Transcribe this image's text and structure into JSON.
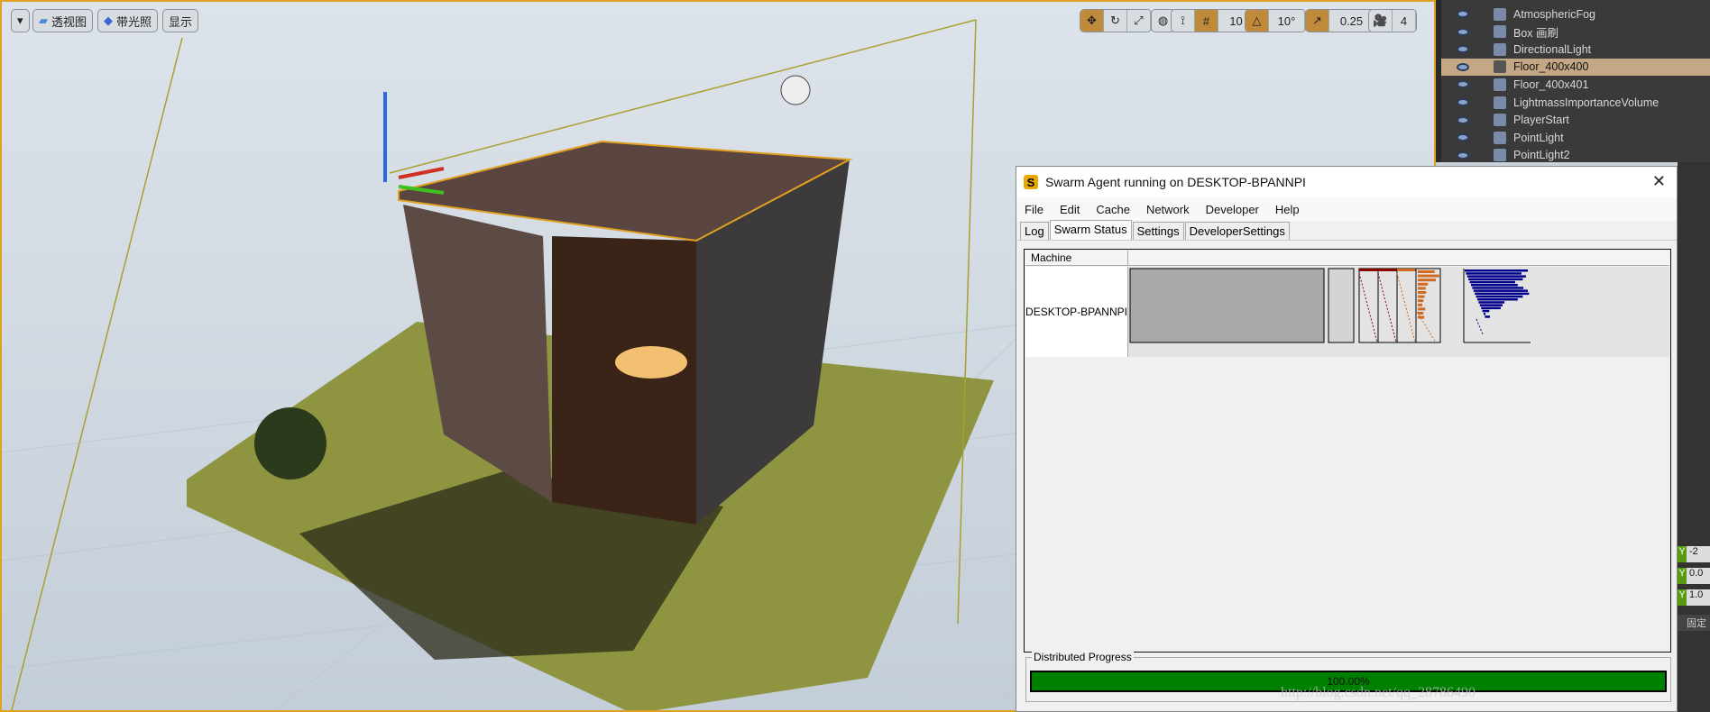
{
  "viewport": {
    "toolbar_left": [
      {
        "label": "",
        "icon": "chevron-down-icon"
      },
      {
        "label": "透视图",
        "icon": "perspective-icon"
      },
      {
        "label": "带光照",
        "icon": "lit-cube-icon"
      },
      {
        "label": "显示",
        "icon": ""
      }
    ],
    "toolbar_right": {
      "grid_snap": "10",
      "rotation_snap": "10°",
      "scale_snap": "0.25",
      "camera_speed": "4"
    },
    "accent": "#c08a3a"
  },
  "outliner": {
    "items": [
      {
        "label": "AtmosphericFog",
        "icon": "fog-icon",
        "selected": false
      },
      {
        "label": "Box 画刷",
        "icon": "brush-icon",
        "selected": false
      },
      {
        "label": "DirectionalLight",
        "icon": "directional-light-icon",
        "selected": false
      },
      {
        "label": "Floor_400x400",
        "icon": "static-mesh-icon",
        "selected": true
      },
      {
        "label": "Floor_400x401",
        "icon": "static-mesh-icon",
        "selected": false
      },
      {
        "label": "LightmassImportanceVolume",
        "icon": "volume-icon",
        "selected": false
      },
      {
        "label": "PlayerStart",
        "icon": "player-start-icon",
        "selected": false
      },
      {
        "label": "PointLight",
        "icon": "point-light-icon",
        "selected": false
      },
      {
        "label": "PointLight2",
        "icon": "point-light-icon",
        "selected": false
      }
    ]
  },
  "details": {
    "values": [
      "-2",
      "0.0",
      "1.0"
    ],
    "axis": "Y",
    "button": "固定"
  },
  "swarm": {
    "title": "Swarm Agent running on DESKTOP-BPANNPI",
    "menu": [
      "File",
      "Edit",
      "Cache",
      "Network",
      "Developer",
      "Help"
    ],
    "tabs": [
      "Log",
      "Swarm Status",
      "Settings",
      "DeveloperSettings"
    ],
    "active_tab": "Swarm Status",
    "column_header": "Machine",
    "machine": "DESKTOP-BPANNPI",
    "progress_label": "Distributed Progress",
    "progress_text": "100.00%",
    "progress_value": 100,
    "progress_color": "#008000",
    "orange_bars": [
      0.75,
      0.95,
      0.8,
      0.45,
      0.35,
      0.37,
      0.3,
      0.25,
      0.2,
      0.33,
      0.25,
      0.29
    ],
    "blue_bars": [
      1.0,
      0.88,
      0.93,
      0.86,
      0.72,
      0.74,
      0.81,
      0.86,
      0.86,
      0.74,
      0.64,
      0.41,
      0.36,
      0.31,
      0.11,
      0.03,
      0.08
    ]
  },
  "watermark": "http://blog.csdn.net/qq_28786490"
}
